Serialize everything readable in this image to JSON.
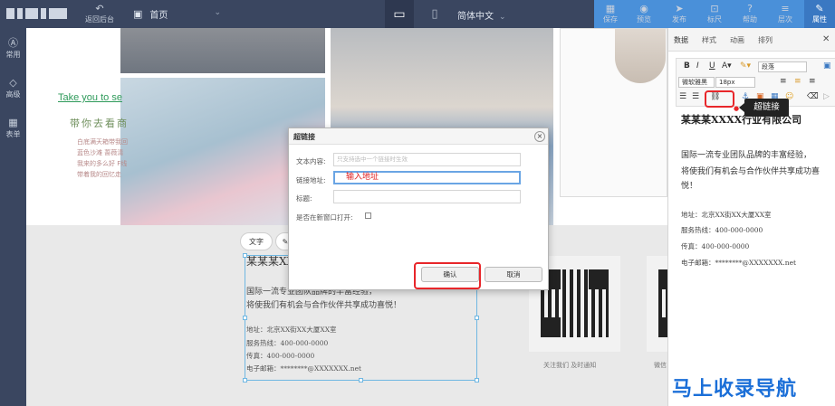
{
  "topbar": {
    "back_label": "返回后台",
    "home_label": "首页",
    "language_label": "简体中文",
    "save_label": "保存",
    "preview_label": "预览",
    "publish_label": "发布",
    "ruler_label": "标尺",
    "help_label": "帮助",
    "layers_label": "层次",
    "properties_label": "属性"
  },
  "sidebar": {
    "items": [
      {
        "label": "常用",
        "icon": "a-circle-icon"
      },
      {
        "label": "高级",
        "icon": "diamond-icon"
      },
      {
        "label": "表单",
        "icon": "grid-icon"
      }
    ]
  },
  "canvas": {
    "promo": {
      "tagline": "Take you to se",
      "title": "带你去看商",
      "lines": [
        "白底满天箱带我回",
        "蓝色沙滩 蔷薇清",
        "我来的多么好 F线",
        "带着我的回忆走"
      ]
    },
    "edit_tabs": {
      "text_label": "文字"
    },
    "company_name_partial": "某某某XX",
    "intro_line1": "国际一流专业团队品牌的丰富经验，",
    "intro_line2": "将使我们有机会与合作伙伴共享成功喜悦！",
    "address": "地址：北京XX街XX大厦XX室",
    "hotline": "服务热线：400-000-0000",
    "fax": "传真：400-000-0000",
    "email": "电子邮箱：********@XXXXXXX.net",
    "qr_caption_1": "关注我们 及时通知",
    "qr_caption_2": "微信"
  },
  "dialog": {
    "title": "超链接",
    "text_label": "文本内容:",
    "text_placeholder": "只支持选中一个链接时生效",
    "url_label": "链接地址:",
    "url_value": "输入地址",
    "title_label": "标题:",
    "title_value": "",
    "new_window_label": "是否在新窗口打开:",
    "new_window_checked": false,
    "ok_label": "确认",
    "cancel_label": "取消"
  },
  "right_panel": {
    "tabs": [
      "数据",
      "样式",
      "动画",
      "排列"
    ],
    "active_tab": "数据",
    "toolbar": {
      "paragraph_select": "段落",
      "font_select": "微软雅黑",
      "size_select": "18px"
    },
    "tooltip": "超链接",
    "company_name": "某某某XXXX行业有限公司",
    "intro_line1": "国际一流专业团队品牌的丰富经验，",
    "intro_line2": "将使我们有机会与合作伙伴共享成功喜",
    "intro_line3": "悦！",
    "address": "地址：北京XX街XX大厦XX室",
    "hotline": "服务热线：400-000-0000",
    "fax": "传真：400-000-0000",
    "email": "电子邮箱：********@XXXXXXX.net"
  },
  "watermark": "马上收录导航",
  "colors": {
    "toolbar_bg": "#3a4660",
    "accent_blue": "#4a90d9",
    "highlight_red": "#e8262a",
    "watermark_blue": "#1b6fd8"
  }
}
